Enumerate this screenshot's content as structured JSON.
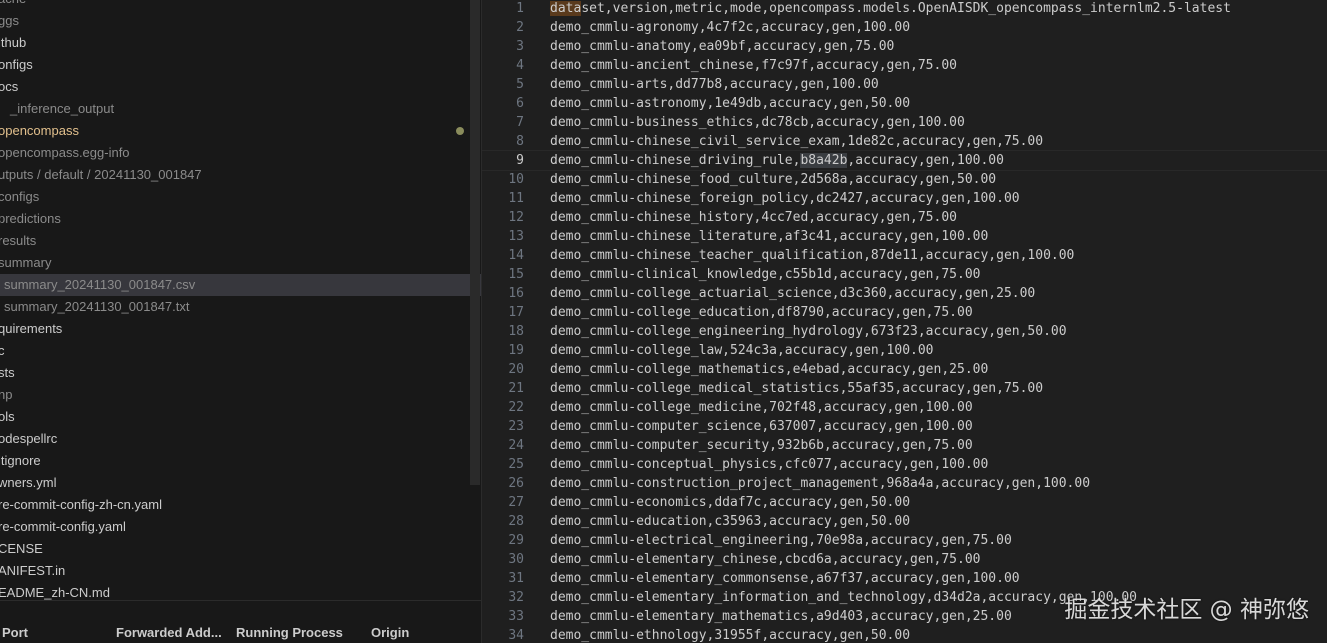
{
  "explorer": {
    "items": [
      {
        "label": "ache",
        "dim": true
      },
      {
        "label": "ggs",
        "dim": true
      },
      {
        "label": "ithub"
      },
      {
        "label": "onfigs"
      },
      {
        "label": "ocs"
      },
      {
        "label": "_inference_output",
        "dim": true
      },
      {
        "label": "opencompass",
        "mod": true,
        "dot": true
      },
      {
        "label": "opencompass.egg-info",
        "dim": true
      },
      {
        "label": "utputs",
        "path": [
          "default",
          "20241130_001847"
        ],
        "dim": true
      },
      {
        "label": "configs",
        "dim": true
      },
      {
        "label": "predictions",
        "dim": true
      },
      {
        "label": "results",
        "dim": true
      },
      {
        "label": "summary",
        "dim": true
      },
      {
        "label": "summary_20241130_001847.csv",
        "dim": true,
        "selected": true
      },
      {
        "label": "summary_20241130_001847.txt",
        "dim": true
      },
      {
        "label": "quirements"
      },
      {
        "label": "c"
      },
      {
        "label": "sts"
      },
      {
        "label": "np",
        "dim": true
      },
      {
        "label": "ols"
      },
      {
        "label": "odespellrc"
      },
      {
        "label": "itignore"
      },
      {
        "label": "wners.yml"
      },
      {
        "label": "re-commit-config-zh-cn.yaml"
      },
      {
        "label": "re-commit-config.yaml"
      },
      {
        "label": "CENSE"
      },
      {
        "label": "ANIFEST.in"
      },
      {
        "label": "EADME_zh-CN.md"
      }
    ]
  },
  "ports_panel": {
    "headers": [
      "Port",
      "Forwarded Add...",
      "Running Process",
      "Origin"
    ]
  },
  "editor": {
    "current_line": 9,
    "lines": [
      "dataset,version,metric,mode,opencompass.models.OpenAISDK_opencompass_internlm2.5-latest",
      "demo_cmmlu-agronomy,4c7f2c,accuracy,gen,100.00",
      "demo_cmmlu-anatomy,ea09bf,accuracy,gen,75.00",
      "demo_cmmlu-ancient_chinese,f7c97f,accuracy,gen,75.00",
      "demo_cmmlu-arts,dd77b8,accuracy,gen,100.00",
      "demo_cmmlu-astronomy,1e49db,accuracy,gen,50.00",
      "demo_cmmlu-business_ethics,dc78cb,accuracy,gen,100.00",
      "demo_cmmlu-chinese_civil_service_exam,1de82c,accuracy,gen,75.00",
      "demo_cmmlu-chinese_driving_rule,b8a42b,accuracy,gen,100.00",
      "demo_cmmlu-chinese_food_culture,2d568a,accuracy,gen,50.00",
      "demo_cmmlu-chinese_foreign_policy,dc2427,accuracy,gen,100.00",
      "demo_cmmlu-chinese_history,4cc7ed,accuracy,gen,75.00",
      "demo_cmmlu-chinese_literature,af3c41,accuracy,gen,100.00",
      "demo_cmmlu-chinese_teacher_qualification,87de11,accuracy,gen,100.00",
      "demo_cmmlu-clinical_knowledge,c55b1d,accuracy,gen,75.00",
      "demo_cmmlu-college_actuarial_science,d3c360,accuracy,gen,25.00",
      "demo_cmmlu-college_education,df8790,accuracy,gen,75.00",
      "demo_cmmlu-college_engineering_hydrology,673f23,accuracy,gen,50.00",
      "demo_cmmlu-college_law,524c3a,accuracy,gen,100.00",
      "demo_cmmlu-college_mathematics,e4ebad,accuracy,gen,25.00",
      "demo_cmmlu-college_medical_statistics,55af35,accuracy,gen,75.00",
      "demo_cmmlu-college_medicine,702f48,accuracy,gen,100.00",
      "demo_cmmlu-computer_science,637007,accuracy,gen,100.00",
      "demo_cmmlu-computer_security,932b6b,accuracy,gen,75.00",
      "demo_cmmlu-conceptual_physics,cfc077,accuracy,gen,100.00",
      "demo_cmmlu-construction_project_management,968a4a,accuracy,gen,100.00",
      "demo_cmmlu-economics,ddaf7c,accuracy,gen,50.00",
      "demo_cmmlu-education,c35963,accuracy,gen,50.00",
      "demo_cmmlu-electrical_engineering,70e98a,accuracy,gen,75.00",
      "demo_cmmlu-elementary_chinese,cbcd6a,accuracy,gen,75.00",
      "demo_cmmlu-elementary_commonsense,a67f37,accuracy,gen,100.00",
      "demo_cmmlu-elementary_information_and_technology,d34d2a,accuracy,gen,100.00",
      "demo_cmmlu-elementary_mathematics,a9d403,accuracy,gen,25.00",
      "demo_cmmlu-ethnology,31955f,accuracy,gen,50.00"
    ]
  },
  "watermark": "掘金技术社区 @ 神弥悠",
  "colors": {
    "editor_bg": "#1f1f1f",
    "sidebar_bg": "#181818",
    "selected_bg": "#37373d",
    "modified": "#e2c08d"
  }
}
